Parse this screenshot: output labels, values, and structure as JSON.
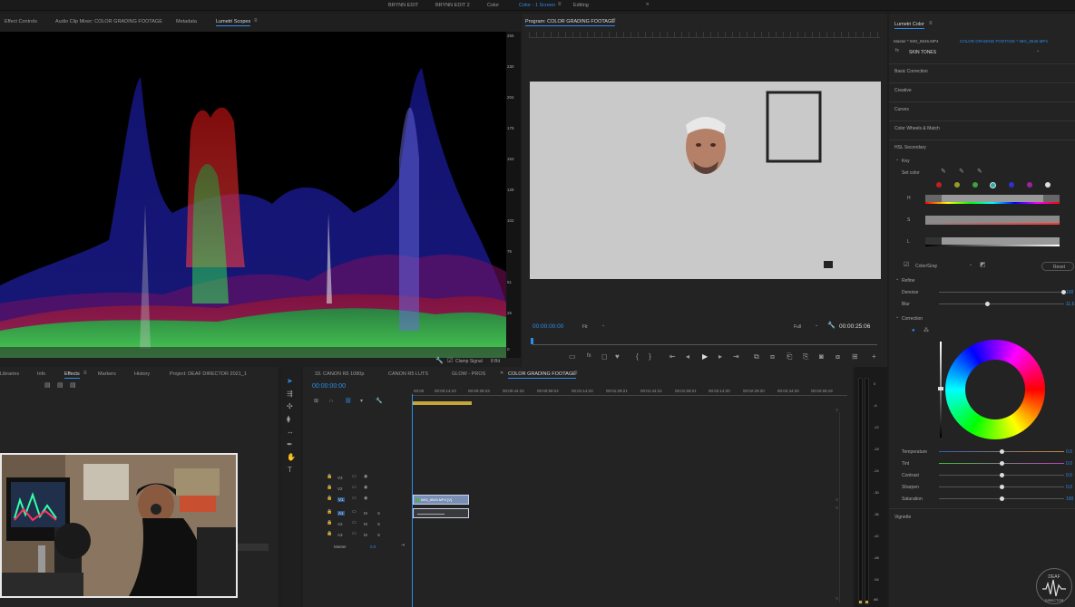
{
  "workspace_tabs": [
    "BRYNN EDIT",
    "BRYNN EDIT 2",
    "Color",
    "Color - 1 Screen",
    "Editing"
  ],
  "workspace_active": "Color - 1 Screen",
  "scope_panel": {
    "tabs": [
      "Effect Controls",
      "Audio Clip Mixer: COLOR GRADING FOOTAGE",
      "Metadata",
      "Lumetri Scopes"
    ],
    "active": "Lumetri Scopes",
    "scale": [
      "255",
      "230",
      "204",
      "179",
      "153",
      "128",
      "102",
      "76",
      "51",
      "26",
      "0"
    ],
    "clamp_label": "Clamp Signal",
    "bit_label": "8 Bit"
  },
  "program_monitor": {
    "title": "Program: COLOR GRADING FOOTAGE",
    "timecode_left": "00:00:00:00",
    "fit": "Fit",
    "quality": "Full",
    "timecode_right": "00:00:25:06"
  },
  "lumetri": {
    "title": "Lumetri Color",
    "master": "Master * IMG_8545.MP4",
    "clip": "COLOR GRADING FOOTAGE * IMG_8545.MP4",
    "preset": "SKIN TONES",
    "sections": [
      "Basic Correction",
      "Creative",
      "Curves",
      "Color Wheels & Match",
      "HSL Secondary"
    ],
    "key_label": "Key",
    "set_color": "Set color",
    "hsl_labels": [
      "H",
      "S",
      "L"
    ],
    "color_gray": "Color/Gray",
    "reset": "Reset",
    "refine_label": "Refine",
    "denoise": "Denoise",
    "denoise_val": "100",
    "blur": "Blur",
    "blur_val": "11.6",
    "correction_label": "Correction",
    "params": [
      {
        "name": "Temperature",
        "value": "0.0",
        "color": "#c68a3a"
      },
      {
        "name": "Tint",
        "value": "0.0",
        "color": "#3fbf3f"
      },
      {
        "name": "Contrast",
        "value": "0.0",
        "color": "#777777"
      },
      {
        "name": "Sharpen",
        "value": "0.0",
        "color": "#777777"
      },
      {
        "name": "Saturation",
        "value": "100",
        "color": "#777777"
      }
    ],
    "vignette": "Vignette",
    "swatch_colors": [
      "#c02020",
      "#9a9a20",
      "#40a040",
      "#20b0b0",
      "#3030d0",
      "#a020a0",
      "#dddddd"
    ]
  },
  "project_panel": {
    "tabs": [
      "Libraries",
      "Info",
      "Effects",
      "Markers",
      "History",
      "Project: DEAF DIRECTOR 2021_1"
    ],
    "active": "Effects"
  },
  "timeline": {
    "tabs": [
      "33. CANON R5 1080p",
      "CANON R5 LUTS",
      "GLOW - PROS",
      "COLOR GRADING FOOTAGE"
    ],
    "active": "COLOR GRADING FOOTAGE",
    "timecode": "00:00:00:00",
    "ruler": [
      "00:00",
      "00:00:14:23",
      "00:00:29:23",
      "00:00:44:22",
      "00:00:59:22",
      "00:01:14:22",
      "00:01:29:21",
      "00:01:44:21",
      "00:01:59:21",
      "00:02:14:20",
      "00:02:29:20",
      "00:02:44:20",
      "00:02:59:19"
    ],
    "tracks": [
      "V3",
      "V2",
      "V1",
      "A1",
      "A2",
      "A3"
    ],
    "master_label": "Master",
    "master_val": "0.0",
    "clip_label": "IMG_8545.MP4 [V]"
  },
  "meter_scale": [
    "0",
    "-6",
    "-12",
    "-18",
    "-24",
    "-30",
    "-36",
    "-42",
    "-48",
    "-54",
    "dB"
  ],
  "watermark": "DEAF DIRECTOR"
}
